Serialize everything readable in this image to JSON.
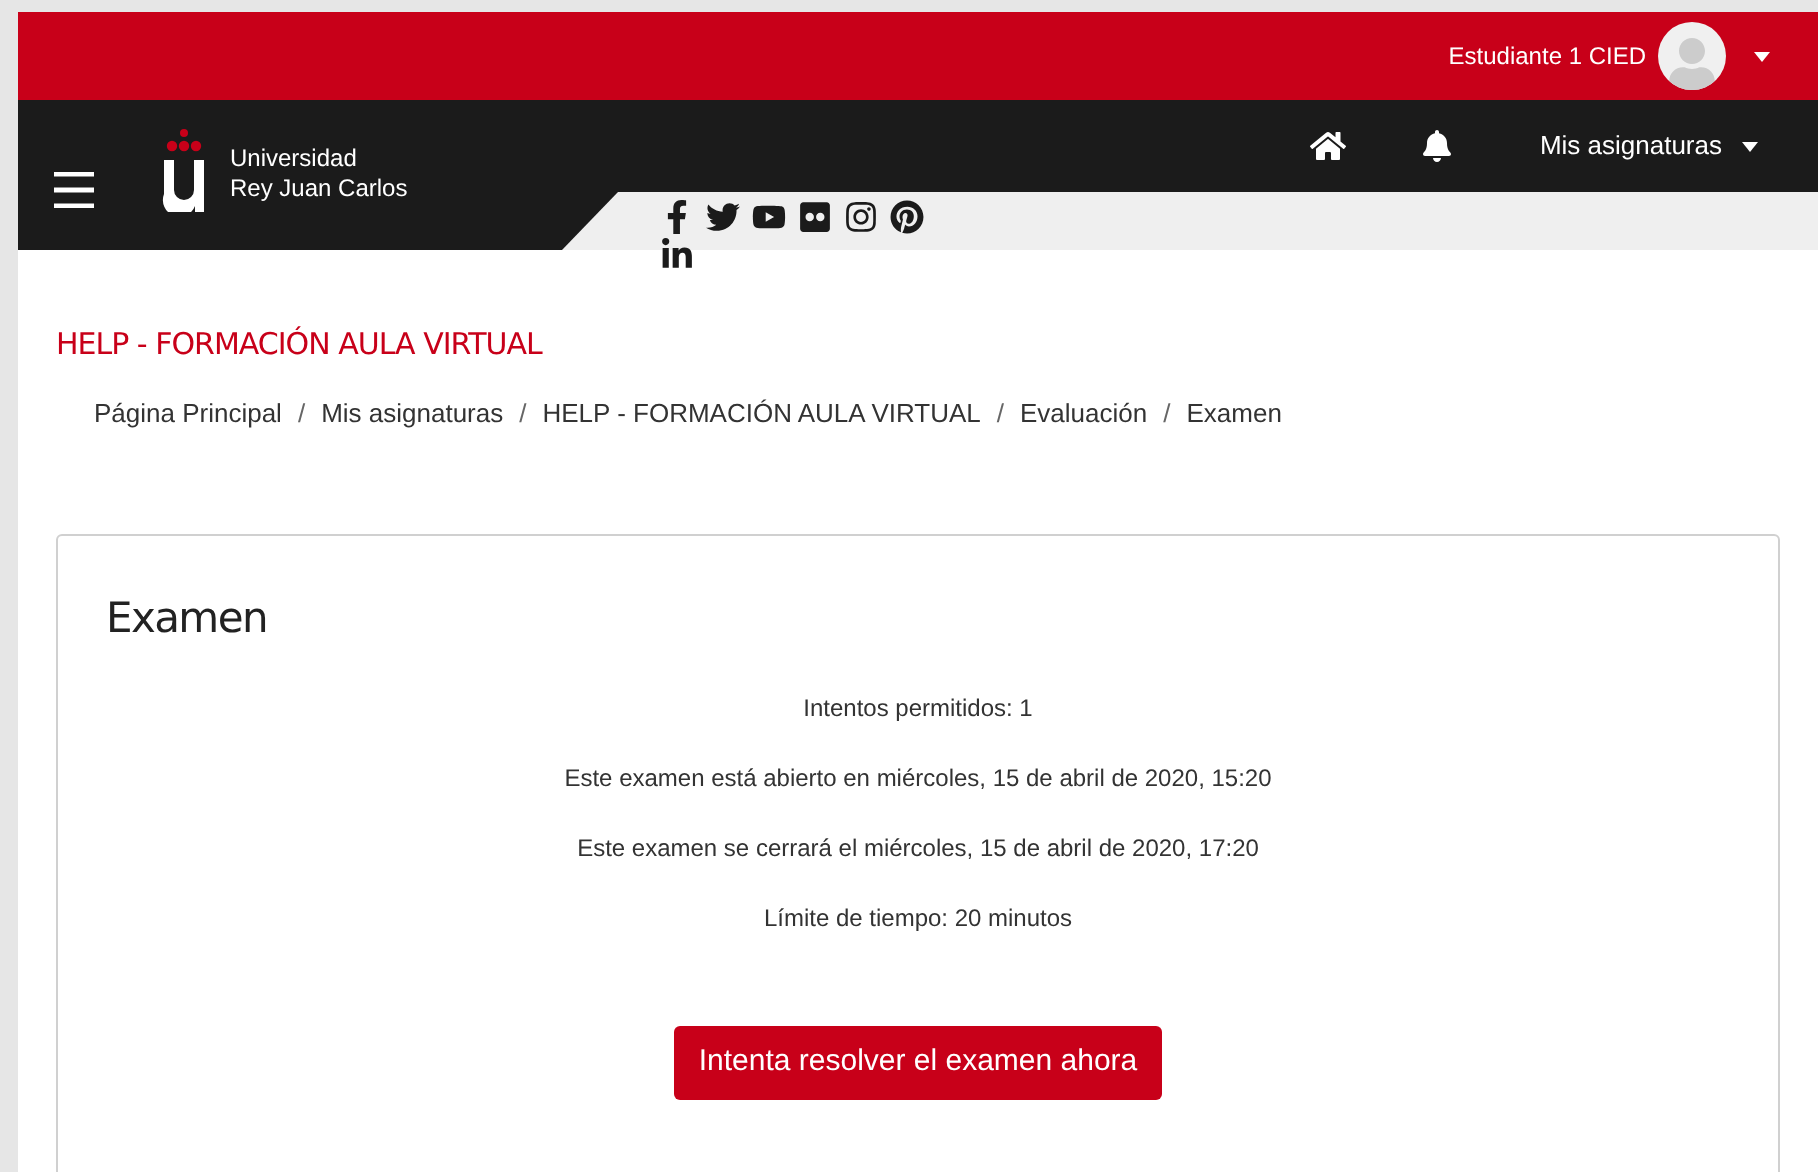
{
  "user_menu": {
    "name": "Estudiante 1 CIED"
  },
  "navbar": {
    "logo_lines": [
      "Universidad",
      "Rey Juan Carlos"
    ],
    "menu": "Mis asignaturas"
  },
  "social_links": [
    {
      "kind": "facebook"
    },
    {
      "kind": "twitter"
    },
    {
      "kind": "youtube"
    },
    {
      "kind": "flickr"
    },
    {
      "kind": "instagram"
    },
    {
      "kind": "pinterest"
    },
    {
      "kind": "linkedin"
    }
  ],
  "course_title": "HELP - FORMACIÓN AULA VIRTUAL",
  "breadcrumb_separator": "/",
  "breadcrumb": [
    "Página Principal",
    "Mis asignaturas",
    "HELP - FORMACIÓN AULA VIRTUAL",
    "Evaluación",
    "Examen"
  ],
  "quiz": {
    "title": "Examen",
    "info": [
      "Intentos permitidos: 1",
      "Este examen está abierto en miércoles, 15 de abril de 2020, 15:20",
      "Este examen se cerrará el miércoles, 15 de abril de 2020, 17:20",
      "Límite de tiempo: 20 minutos"
    ],
    "button": "Intenta resolver el examen ahora"
  }
}
